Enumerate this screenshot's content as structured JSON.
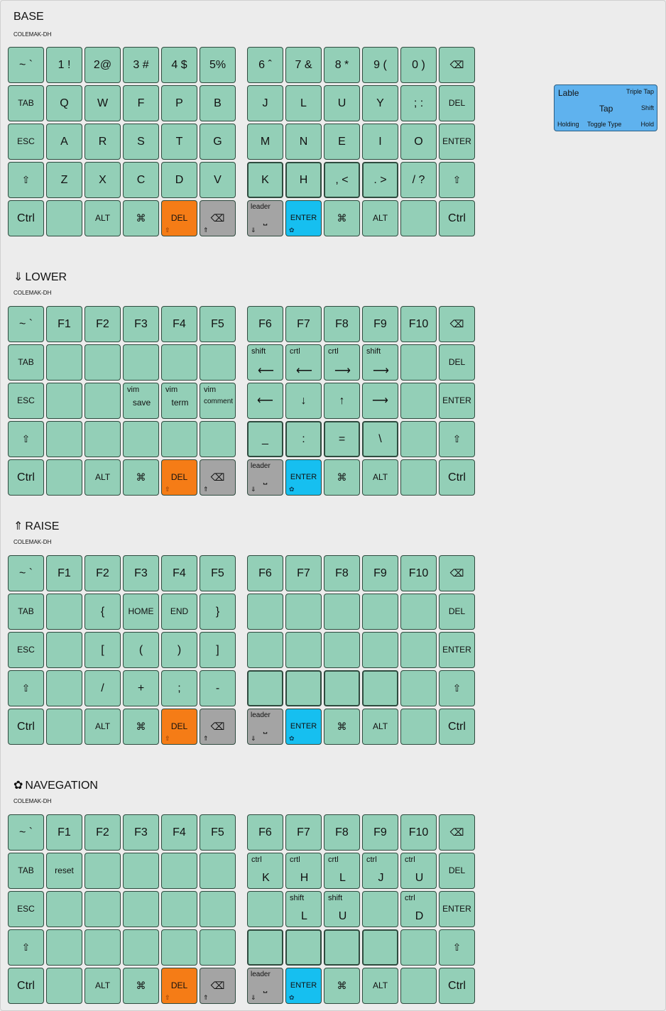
{
  "layers": [
    {
      "id": "base",
      "icon": "",
      "title": "BASE",
      "subtitle": "COLEMAK-DH",
      "rows": [
        [
          {
            "t": "~  `"
          },
          {
            "t": "1  !"
          },
          {
            "t": "2@"
          },
          {
            "t": "3  #"
          },
          {
            "t": "4  $"
          },
          {
            "t": "5%"
          },
          {
            "t": "6  ˆ"
          },
          {
            "t": "7 &"
          },
          {
            "t": "8  *"
          },
          {
            "t": "9  ("
          },
          {
            "t": "0  )"
          },
          {
            "t": "⌫",
            "icon": "backspace-icon"
          }
        ],
        [
          {
            "t": "TAB",
            "size": "small"
          },
          {
            "t": "Q"
          },
          {
            "t": "W"
          },
          {
            "t": "F"
          },
          {
            "t": "P"
          },
          {
            "t": "B"
          },
          {
            "t": "J"
          },
          {
            "t": "L"
          },
          {
            "t": "U"
          },
          {
            "t": "Y"
          },
          {
            "t": ";  :"
          },
          {
            "t": "DEL",
            "size": "small"
          }
        ],
        [
          {
            "t": "ESC",
            "size": "small"
          },
          {
            "t": "A"
          },
          {
            "t": "R"
          },
          {
            "t": "S"
          },
          {
            "t": "T"
          },
          {
            "t": "G"
          },
          {
            "t": "M"
          },
          {
            "t": "N"
          },
          {
            "t": "E"
          },
          {
            "t": "I"
          },
          {
            "t": "O"
          },
          {
            "t": "ENTER",
            "size": "small"
          }
        ],
        [
          {
            "t": "⇧",
            "icon": "shift-icon",
            "size": "small"
          },
          {
            "t": "Z"
          },
          {
            "t": "X"
          },
          {
            "t": "C"
          },
          {
            "t": "D"
          },
          {
            "t": "V"
          },
          {
            "t": "K",
            "thick": true
          },
          {
            "t": "H",
            "thick": true
          },
          {
            "t": ",  <",
            "thick": true
          },
          {
            "t": ".  >",
            "thick": true
          },
          {
            "t": "/  ?"
          },
          {
            "t": "⇧",
            "icon": "shift-icon",
            "size": "small"
          }
        ]
      ]
    },
    {
      "id": "lower",
      "icon": "⇓",
      "title": "LOWER",
      "subtitle": "COLEMAK-DH",
      "rows": [
        [
          {
            "t": "~  `"
          },
          {
            "t": "F1"
          },
          {
            "t": "F2"
          },
          {
            "t": "F3"
          },
          {
            "t": "F4"
          },
          {
            "t": "F5"
          },
          {
            "t": "F6"
          },
          {
            "t": "F7"
          },
          {
            "t": "F8"
          },
          {
            "t": "F9"
          },
          {
            "t": "F10"
          },
          {
            "t": "⌫",
            "icon": "backspace-icon"
          }
        ],
        [
          {
            "t": "TAB",
            "size": "small"
          },
          {
            "t": ""
          },
          {
            "t": ""
          },
          {
            "t": ""
          },
          {
            "t": ""
          },
          {
            "t": ""
          },
          {
            "tl": "shift",
            "c": "⟵"
          },
          {
            "tl": "crtl",
            "c": "⟵"
          },
          {
            "tl": "crtl",
            "c": "⟶"
          },
          {
            "tl": "shift",
            "c": "⟶"
          },
          {
            "t": ""
          },
          {
            "t": "DEL",
            "size": "small"
          }
        ],
        [
          {
            "t": "ESC",
            "size": "small"
          },
          {
            "t": ""
          },
          {
            "t": ""
          },
          {
            "tl": "vim",
            "c": "save"
          },
          {
            "tl": "vim",
            "c": "term"
          },
          {
            "tl": "vim",
            "c": "comment"
          },
          {
            "t": "⟵"
          },
          {
            "t": "↓"
          },
          {
            "t": "↑"
          },
          {
            "t": "⟶"
          },
          {
            "t": ""
          },
          {
            "t": "ENTER",
            "size": "small"
          }
        ],
        [
          {
            "t": "⇧",
            "icon": "shift-icon",
            "size": "small"
          },
          {
            "t": ""
          },
          {
            "t": ""
          },
          {
            "t": ""
          },
          {
            "t": ""
          },
          {
            "t": ""
          },
          {
            "t": "_",
            "thick": true
          },
          {
            "t": ":",
            "thick": true
          },
          {
            "t": "=",
            "thick": true
          },
          {
            "t": "\\",
            "thick": true
          },
          {
            "t": ""
          },
          {
            "t": "⇧",
            "icon": "shift-icon",
            "size": "small"
          }
        ]
      ]
    },
    {
      "id": "raise",
      "icon": "⇑",
      "title": "RAISE",
      "subtitle": "COLEMAK-DH",
      "rows": [
        [
          {
            "t": "~  `"
          },
          {
            "t": "F1"
          },
          {
            "t": "F2"
          },
          {
            "t": "F3"
          },
          {
            "t": "F4"
          },
          {
            "t": "F5"
          },
          {
            "t": "F6"
          },
          {
            "t": "F7"
          },
          {
            "t": "F8"
          },
          {
            "t": "F9"
          },
          {
            "t": "F10"
          },
          {
            "t": "⌫",
            "icon": "backspace-icon"
          }
        ],
        [
          {
            "t": "TAB",
            "size": "small"
          },
          {
            "t": ""
          },
          {
            "t": "{"
          },
          {
            "t": "HOME",
            "size": "small"
          },
          {
            "t": "END",
            "size": "small"
          },
          {
            "t": "}"
          },
          {
            "t": ""
          },
          {
            "t": ""
          },
          {
            "t": ""
          },
          {
            "t": ""
          },
          {
            "t": ""
          },
          {
            "t": "DEL",
            "size": "small"
          }
        ],
        [
          {
            "t": "ESC",
            "size": "small"
          },
          {
            "t": ""
          },
          {
            "t": "["
          },
          {
            "t": "("
          },
          {
            "t": ")"
          },
          {
            "t": "]"
          },
          {
            "t": ""
          },
          {
            "t": ""
          },
          {
            "t": ""
          },
          {
            "t": ""
          },
          {
            "t": ""
          },
          {
            "t": "ENTER",
            "size": "small"
          }
        ],
        [
          {
            "t": "⇧",
            "icon": "shift-icon",
            "size": "small"
          },
          {
            "t": ""
          },
          {
            "t": "/"
          },
          {
            "t": "+"
          },
          {
            "t": ";"
          },
          {
            "t": "-"
          },
          {
            "t": "",
            "thick": true
          },
          {
            "t": "",
            "thick": true
          },
          {
            "t": "",
            "thick": true
          },
          {
            "t": "",
            "thick": true
          },
          {
            "t": ""
          },
          {
            "t": "⇧",
            "icon": "shift-icon",
            "size": "small"
          }
        ]
      ]
    },
    {
      "id": "navegation",
      "icon": "✿",
      "title": "NAVEGATION",
      "subtitle": "COLEMAK-DH",
      "rows": [
        [
          {
            "t": "~  `"
          },
          {
            "t": "F1"
          },
          {
            "t": "F2"
          },
          {
            "t": "F3"
          },
          {
            "t": "F4"
          },
          {
            "t": "F5"
          },
          {
            "t": "F6"
          },
          {
            "t": "F7"
          },
          {
            "t": "F8"
          },
          {
            "t": "F9"
          },
          {
            "t": "F10"
          },
          {
            "t": "⌫",
            "icon": "backspace-icon"
          }
        ],
        [
          {
            "t": "TAB",
            "size": "small"
          },
          {
            "t": "reset",
            "size": "small"
          },
          {
            "t": ""
          },
          {
            "t": ""
          },
          {
            "t": ""
          },
          {
            "t": ""
          },
          {
            "tl": "ctrl",
            "c": "K"
          },
          {
            "tl": "crtl",
            "c": "H"
          },
          {
            "tl": "crtl",
            "c": "L"
          },
          {
            "tl": "ctrl",
            "c": "J"
          },
          {
            "tl": "ctrl",
            "c": "U"
          },
          {
            "t": "DEL",
            "size": "small"
          }
        ],
        [
          {
            "t": "ESC",
            "size": "small"
          },
          {
            "t": ""
          },
          {
            "t": ""
          },
          {
            "t": ""
          },
          {
            "t": ""
          },
          {
            "t": ""
          },
          {
            "t": ""
          },
          {
            "tl": "shift",
            "c": "L"
          },
          {
            "tl": "shift",
            "c": "U"
          },
          {
            "t": ""
          },
          {
            "tl": "ctrl",
            "c": "D"
          },
          {
            "t": "ENTER",
            "size": "small"
          }
        ],
        [
          {
            "t": "⇧",
            "icon": "shift-icon",
            "size": "small"
          },
          {
            "t": ""
          },
          {
            "t": ""
          },
          {
            "t": ""
          },
          {
            "t": ""
          },
          {
            "t": ""
          },
          {
            "t": "",
            "thick": true
          },
          {
            "t": "",
            "thick": true
          },
          {
            "t": "",
            "thick": true
          },
          {
            "t": "",
            "thick": true
          },
          {
            "t": ""
          },
          {
            "t": "⇧",
            "icon": "shift-icon",
            "size": "small"
          }
        ]
      ]
    }
  ],
  "thumb_row": [
    {
      "t": "Ctrl"
    },
    {
      "t": ""
    },
    {
      "t": "ALT",
      "size": "small"
    },
    {
      "t": "⌘",
      "icon": "command-icon"
    },
    {
      "t": "DEL",
      "size": "small",
      "color": "del",
      "bl": "⇧"
    },
    {
      "t": "⌫",
      "icon": "backspace-icon",
      "color": "gray",
      "bl": "⇑"
    },
    {
      "leader": "leader",
      "c": "⎵",
      "color": "gray",
      "bl": "⇓"
    },
    {
      "t": "ENTER",
      "size": "tiny",
      "color": "enter",
      "bl": "✿"
    },
    {
      "t": "⌘",
      "icon": "command-icon"
    },
    {
      "t": "ALT",
      "size": "small"
    },
    {
      "t": ""
    },
    {
      "t": "Ctrl"
    }
  ],
  "legend": {
    "label": "Lable",
    "triple_tap": "Triple Tap",
    "tap": "Tap",
    "shift": "Shift",
    "holding": "Holding",
    "toggle_type": "Toggle Type",
    "hold": "Hold"
  },
  "colors": {
    "key": "#93cfb7",
    "del": "#f57c16",
    "enter": "#16bff0",
    "gray": "#a4a4a4",
    "legend": "#5fb2ee"
  }
}
